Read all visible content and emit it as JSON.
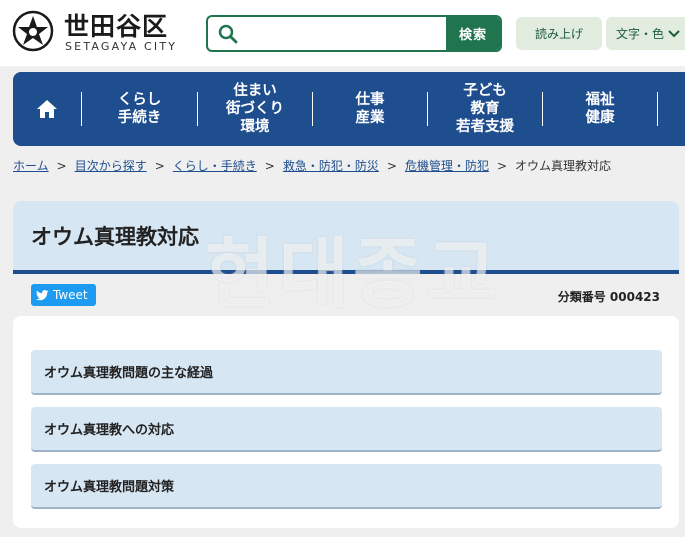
{
  "header": {
    "logo_jp": "世田谷区",
    "logo_en": "SETAGAYA CITY",
    "search": {
      "placeholder": "",
      "button_label": "検索"
    },
    "read_aloud_label": "読み上げ",
    "text_color_label": "文字・色"
  },
  "nav": {
    "items": [
      {
        "label": "くらし\n手続き"
      },
      {
        "label": "住まい\n街づくり\n環境"
      },
      {
        "label": "仕事\n産業"
      },
      {
        "label": "子ども\n教育\n若者支援"
      },
      {
        "label": "福祉\n健康"
      }
    ]
  },
  "breadcrumb": {
    "links": [
      "ホーム",
      "目次から探す",
      "くらし・手続き",
      "救急・防犯・防災",
      "危機管理・防犯"
    ],
    "current": "オウム真理教対応"
  },
  "page": {
    "title": "オウム真理教対応",
    "tweet_label": "Tweet",
    "category_number": "分類番号 000423"
  },
  "links": [
    {
      "label": "オウム真理教問題の主な経過"
    },
    {
      "label": "オウム真理教への対応"
    },
    {
      "label": "オウム真理教問題対策"
    }
  ],
  "watermark": "현대종교",
  "colors": {
    "brand_green": "#20754f",
    "nav_blue": "#1f4e8f",
    "panel_blue": "#d6e6f2",
    "twitter_blue": "#1d9bf0"
  }
}
